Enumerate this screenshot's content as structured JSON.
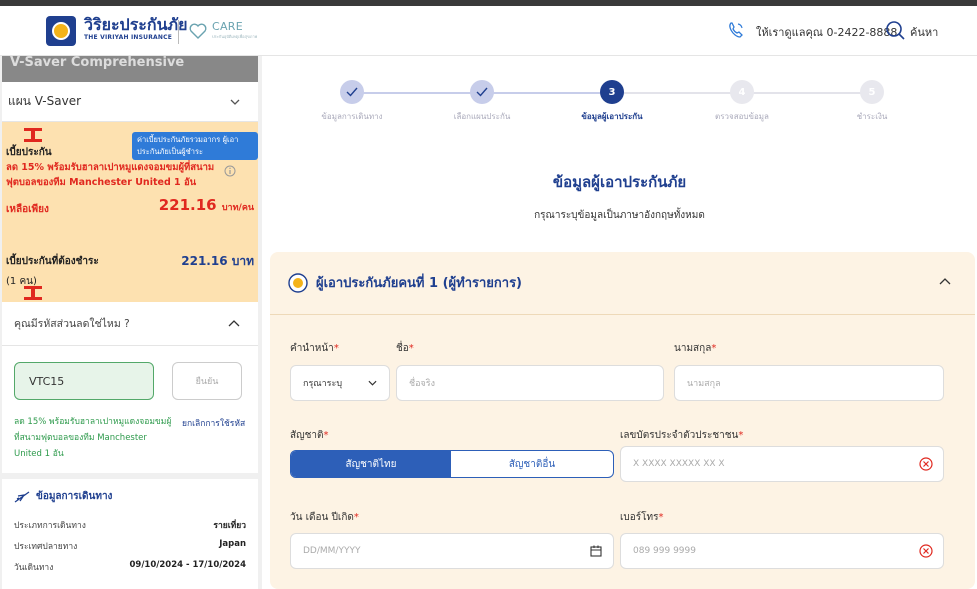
{
  "header": {
    "brand_th": "วิริยะประกันภัย",
    "brand_en": "THE VIRIYAH INSURANCE",
    "care_title": "CARE",
    "care_sub": "ประกันอุบัติเหตุเพื่อสุขภาพ",
    "phone_text": "ให้เราดูแลคุณ 0-2422-8888",
    "search_text": "ค้นหา",
    "brand_color": "#1f3f8f"
  },
  "sidebar": {
    "title": "V-Saver Comprehensive",
    "plan": "แผน V-Saver",
    "tooltip": "ค่าเบี้ยประกันภัยรวมอากร ผู้เอาประกันภัยเป็นผู้ชำระ",
    "premium_label": "เบี้ยประกัน",
    "promo": "ลด 15% พร้อมรับฮาลาเปาหมูแดงจอมขมผู้ที่สนามฟุตบอลของทีม Manchester United 1 อัน",
    "only_label": "เหลือเพียง",
    "price": "221.16",
    "price_unit": "บาท/คน",
    "total_label": "เบี้ยประกันที่ต้องชำระ",
    "total_value": "221.16 บาท",
    "count": "(1 คน)",
    "coupon_question": "คุณมีรหัสส่วนลดใช่ไหม ?",
    "coupon_code": "VTC15",
    "confirm_label": "ยืนยัน",
    "coupon_note": "ลด 15% พร้อมรับฮาลาเปาหมูแดงจอมขมผู้ที่สนามฟุตบอลของทีม Manchester United 1 อัน",
    "cancel_code": "ยกเลิกการใช้รหัส",
    "travel_title": "ข้อมูลการเดินทาง",
    "travel_rows": [
      {
        "k": "ประเภทการเดินทาง",
        "v": "รายเที่ยว"
      },
      {
        "k": "ประเทศปลายทาง",
        "v": "Japan"
      },
      {
        "k": "วันเดินทาง",
        "v": "09/10/2024 - 17/10/2024"
      }
    ]
  },
  "steps": [
    {
      "num": "1",
      "label": "ข้อมูลการเดินทาง",
      "state": "done"
    },
    {
      "num": "2",
      "label": "เลือกแผนประกัน",
      "state": "done"
    },
    {
      "num": "3",
      "label": "ข้อมูลผู้เอาประกัน",
      "state": "current"
    },
    {
      "num": "4",
      "label": "ตรวจสอบข้อมูล",
      "state": "todo"
    },
    {
      "num": "5",
      "label": "ชำระเงิน",
      "state": "todo"
    }
  ],
  "main": {
    "title": "ข้อมูลผู้เอาประกันภัย",
    "subtitle": "กรุณาระบุข้อมูลเป็นภาษาอังกฤษทั้งหมด",
    "card_title": "ผู้เอาประกันภัยคนที่ 1 (ผู้ทำรายการ)",
    "prefix_label": "คำนำหน้า",
    "prefix_value": "กรุณาระบุ",
    "firstname_label": "ชื่อ",
    "firstname_placeholder": "ชื่อจริง",
    "lastname_label": "นามสกุล",
    "lastname_placeholder": "นามสกุล",
    "nationality_label": "สัญชาติ",
    "nationality_thai": "สัญชาติไทย",
    "nationality_other": "สัญชาติอื่น",
    "idcard_label": "เลขบัตรประจำตัวประชาชน",
    "idcard_placeholder": "X XXXX XXXXX XX X",
    "dob_label": "วัน เดือน ปีเกิด",
    "dob_placeholder": "DD/MM/YYYY",
    "phone_label": "เบอร์โทร",
    "phone_placeholder": "089 999 9999"
  }
}
